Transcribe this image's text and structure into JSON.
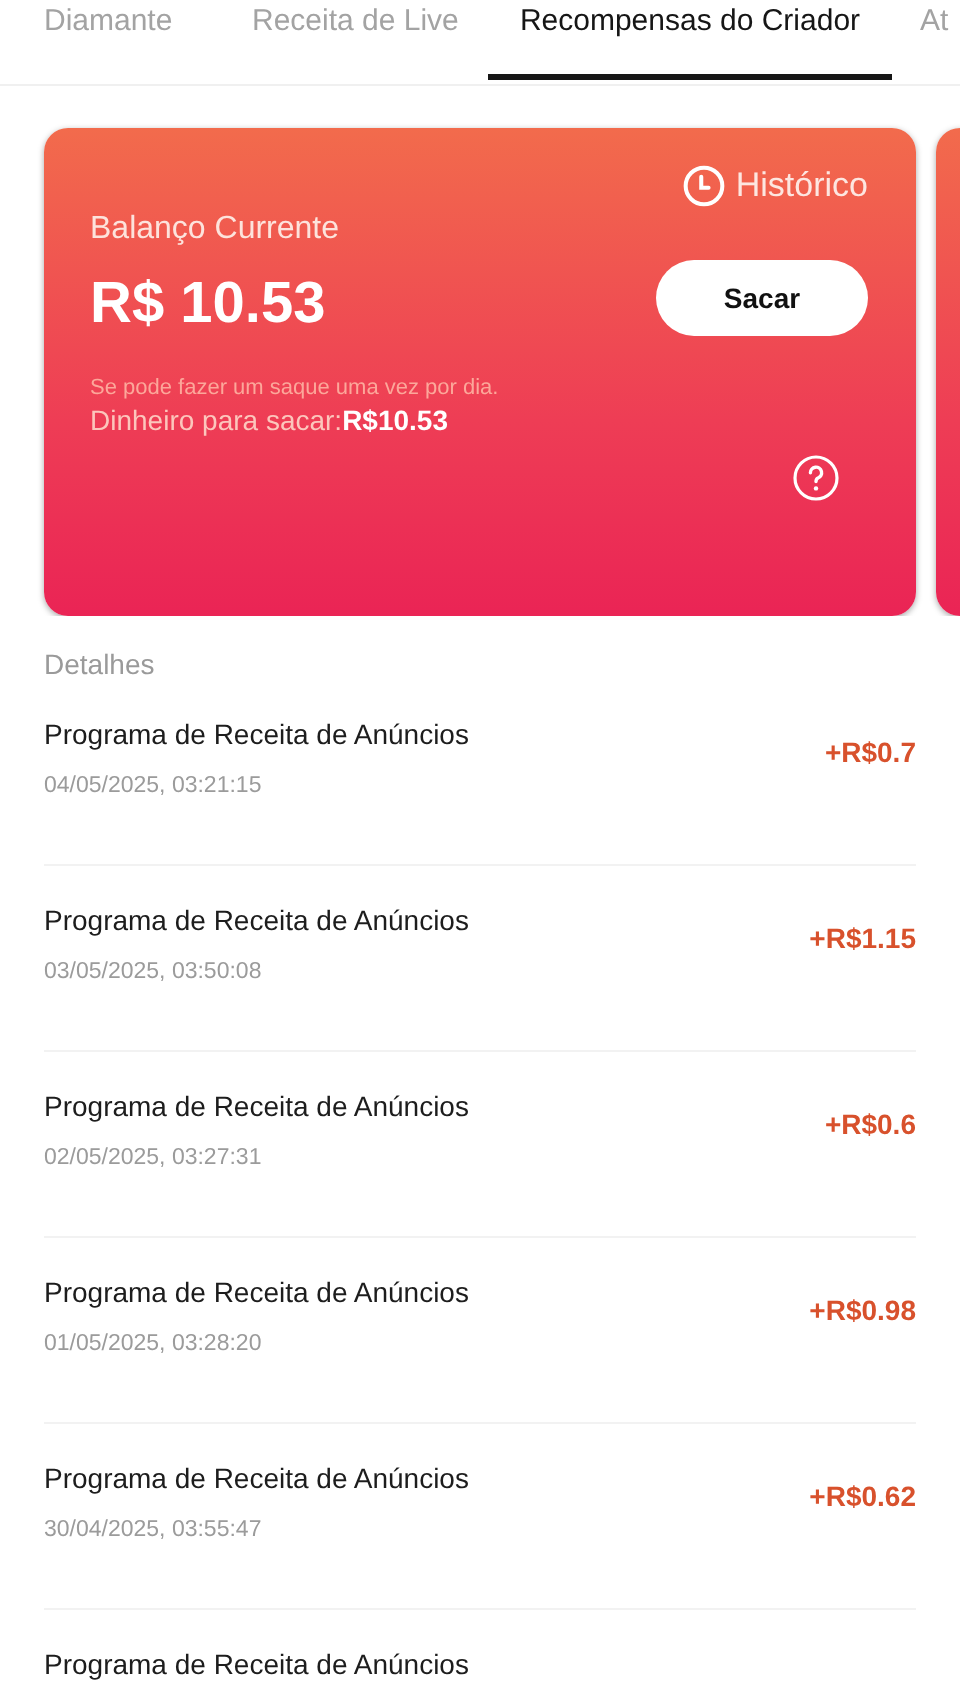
{
  "tabs": [
    {
      "label": "Diamante",
      "selected": false
    },
    {
      "label": "Receita de Live",
      "selected": false
    },
    {
      "label": "Recompensas do Criador",
      "selected": true
    },
    {
      "label": "At",
      "selected": false
    }
  ],
  "balance_card": {
    "history_link": "Histórico",
    "title": "Balanço Currente",
    "amount": "R$ 10.53",
    "withdraw_button": "Sacar",
    "note": "Se pode fazer um saque uma vez por dia.",
    "available_label": "Dinheiro para sacar:",
    "available_amount": "R$10.53"
  },
  "details": {
    "heading": "Detalhes",
    "rows": [
      {
        "title": "Programa de Receita de Anúncios",
        "date": "04/05/2025, 03:21:15",
        "amount": "+R$0.7"
      },
      {
        "title": "Programa de Receita de Anúncios",
        "date": "03/05/2025, 03:50:08",
        "amount": "+R$1.15"
      },
      {
        "title": "Programa de Receita de Anúncios",
        "date": "02/05/2025, 03:27:31",
        "amount": "+R$0.6"
      },
      {
        "title": "Programa de Receita de Anúncios",
        "date": "01/05/2025, 03:28:20",
        "amount": "+R$0.98"
      },
      {
        "title": "Programa de Receita de Anúncios",
        "date": "30/04/2025, 03:55:47",
        "amount": "+R$0.62"
      },
      {
        "title": "Programa de Receita de Anúncios"
      }
    ]
  }
}
